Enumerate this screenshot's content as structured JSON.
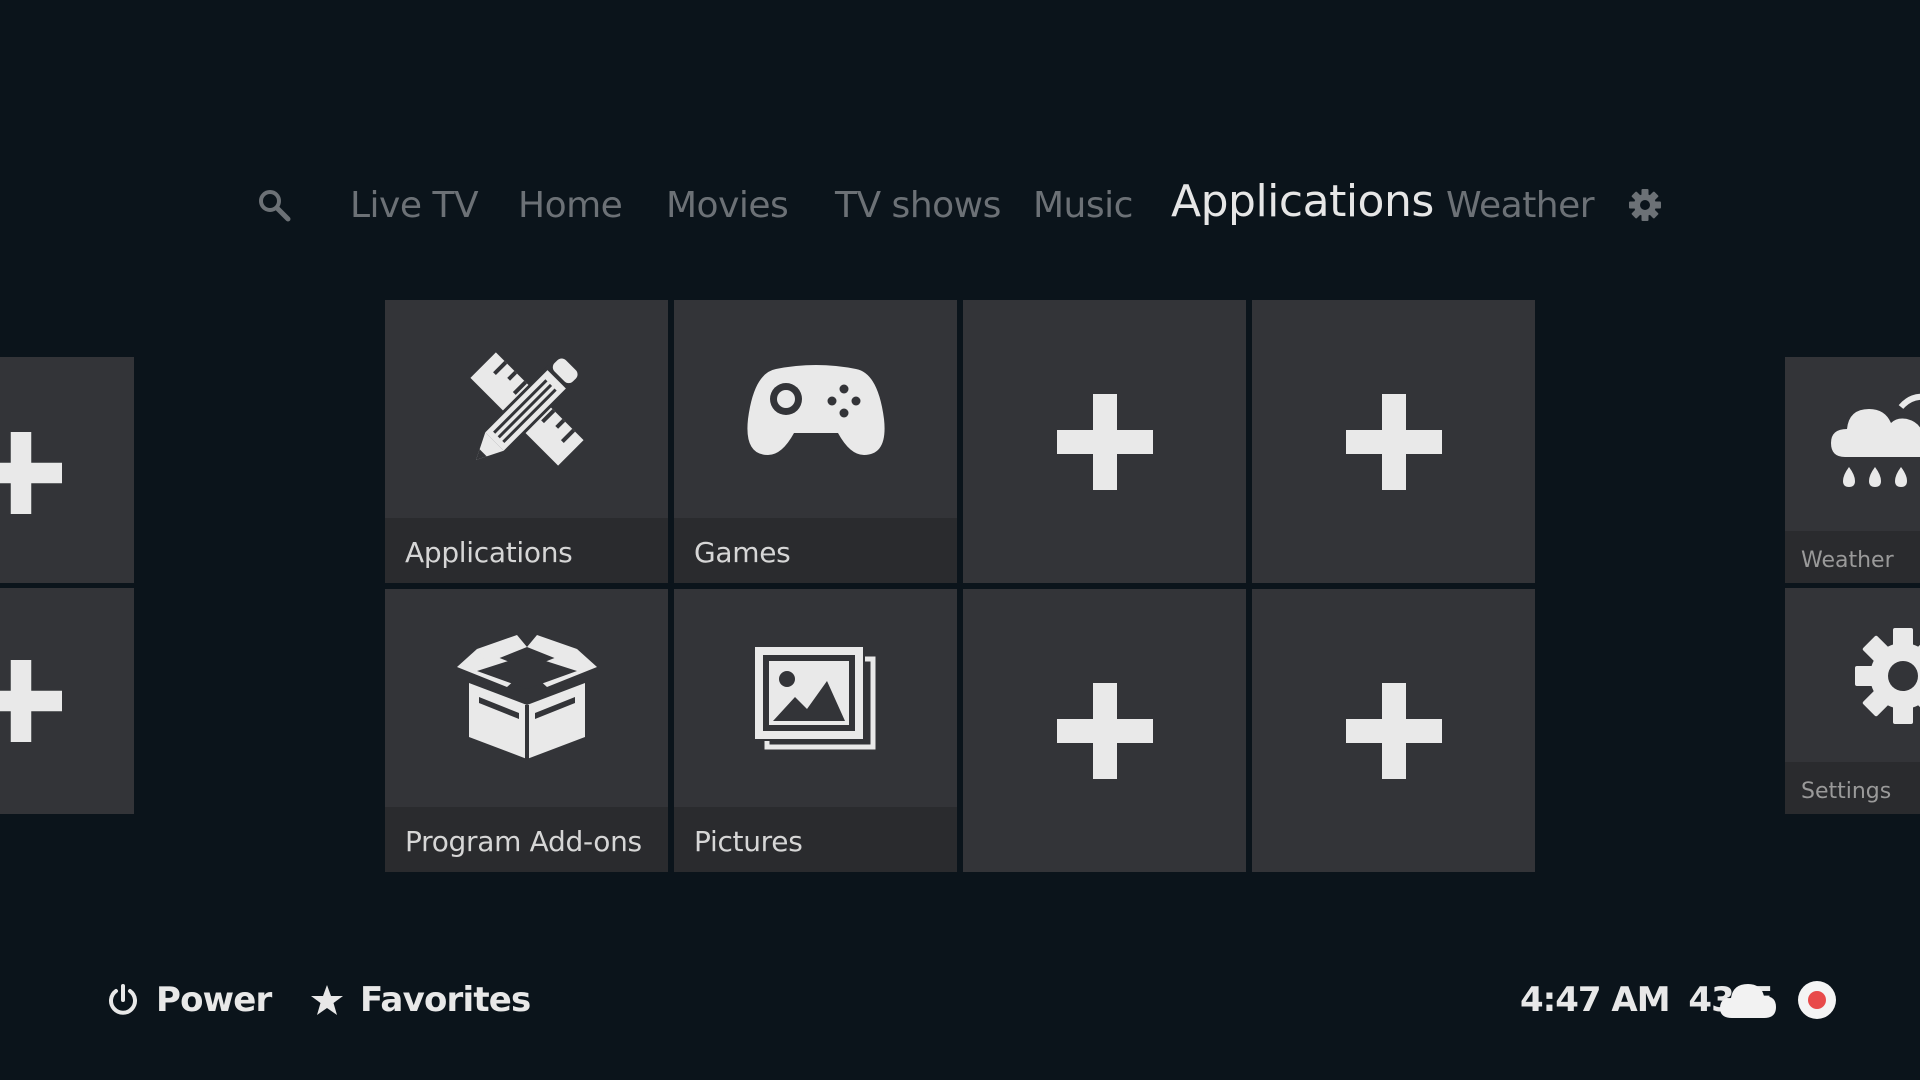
{
  "nav": {
    "search_icon": "search-icon",
    "items": [
      {
        "label": "Live TV"
      },
      {
        "label": "Home"
      },
      {
        "label": "Movies"
      },
      {
        "label": "TV shows"
      },
      {
        "label": "Music"
      },
      {
        "label": "Applications",
        "active": true
      },
      {
        "label": "Weather"
      }
    ],
    "settings_icon": "gear-icon"
  },
  "tiles": [
    {
      "label": "Applications",
      "icon": "pencil-ruler-icon"
    },
    {
      "label": "Games",
      "icon": "gamepad-icon"
    },
    {
      "label": "",
      "icon": "plus-icon"
    },
    {
      "label": "",
      "icon": "plus-icon"
    },
    {
      "label": "Program Add-ons",
      "icon": "open-box-icon"
    },
    {
      "label": "Pictures",
      "icon": "pictures-icon"
    },
    {
      "label": "",
      "icon": "plus-icon"
    },
    {
      "label": "",
      "icon": "plus-icon"
    }
  ],
  "side_tiles": {
    "left": [
      {
        "icon": "plus-icon"
      },
      {
        "icon": "plus-icon"
      }
    ],
    "right": [
      {
        "label": "Weather",
        "icon": "rain-cloud-icon"
      },
      {
        "label": "Settings",
        "icon": "gear-icon"
      }
    ]
  },
  "footer": {
    "power_label": "Power",
    "favorites_label": "Favorites",
    "time": "4:47 AM",
    "temperature": "43°F",
    "weather_icon": "cloud-icon",
    "record_icon": "record-indicator-icon"
  },
  "colors": {
    "background": "#0b141b",
    "tile": "#333438",
    "tile_label_bar": "#2a2b2e",
    "nav_inactive": "#6c7176",
    "nav_active": "#e6e6e6",
    "record_red": "#e84a4a"
  }
}
